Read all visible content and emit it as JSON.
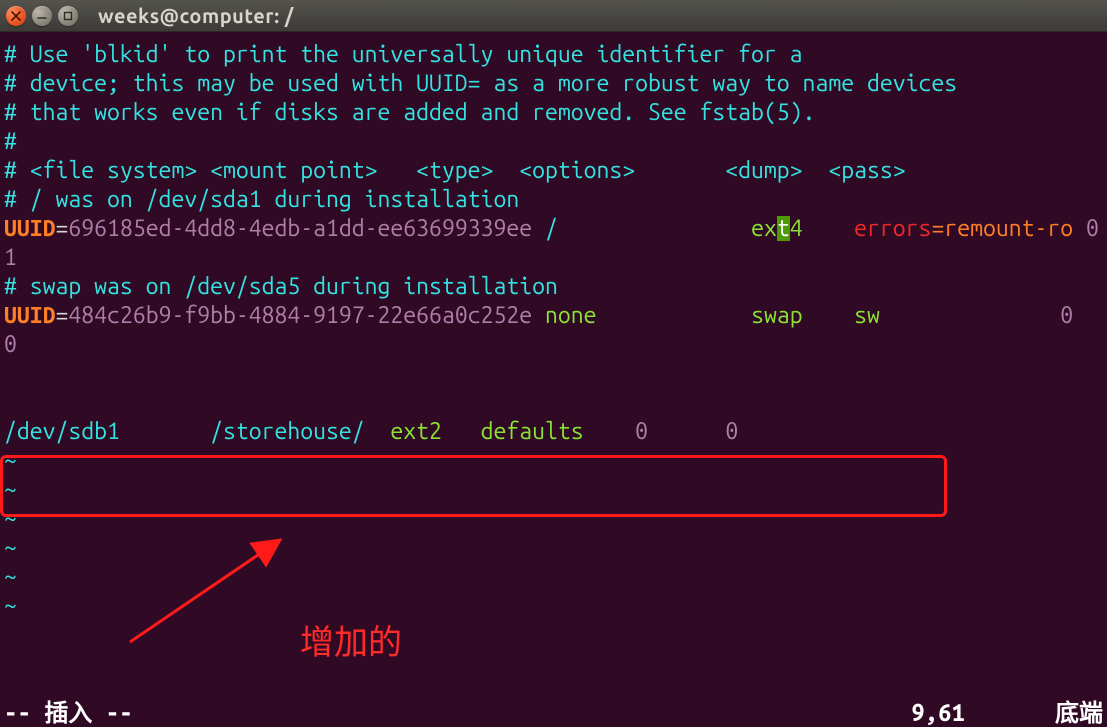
{
  "window": {
    "title": "weeks@computer: /"
  },
  "lines": {
    "c1": "# Use 'blkid' to print the universally unique identifier for a",
    "c2": "# device; this may be used with UUID= as a more robust way to name devices",
    "c3": "# that works even if disks are added and removed. See fstab(5).",
    "c4": "#",
    "c5": "# <file system> <mount point>   <type>  <options>       <dump>  <pass>",
    "c6": "# / was on /dev/sda1 during installation",
    "c7": "# swap was on /dev/sda5 during installation"
  },
  "entry1": {
    "key": "UUID",
    "eq": "=",
    "uuid": "696185ed-4dd8-4edb-a1dd-ee63699339ee",
    "mnt": " /               ",
    "fs_pre": "ex",
    "fs_cursor": "t",
    "fs_post": "4",
    "opts_errors": "    errors",
    "opts_rest": "=remount-ro ",
    "dump": "0       ",
    "pass": "1"
  },
  "entry2": {
    "key": "UUID",
    "eq": "=",
    "uuid": "484c26b9-f9bb-4884-9197-22e66a0c252e",
    "mnt": " none            ",
    "fs": "swap    ",
    "opts": "sw              ",
    "dump": "0       ",
    "pass": "0"
  },
  "added": {
    "dev": "/dev/sdb1       ",
    "mnt": "/storehouse/  ",
    "fs": "ext2   ",
    "opts": "defaults    ",
    "dump": "0      ",
    "pass": "0"
  },
  "tilde": "~",
  "status": {
    "mode": "-- 插入 --",
    "pos": "9,61",
    "scroll": "底端"
  },
  "annotation": {
    "label": "增加的"
  }
}
